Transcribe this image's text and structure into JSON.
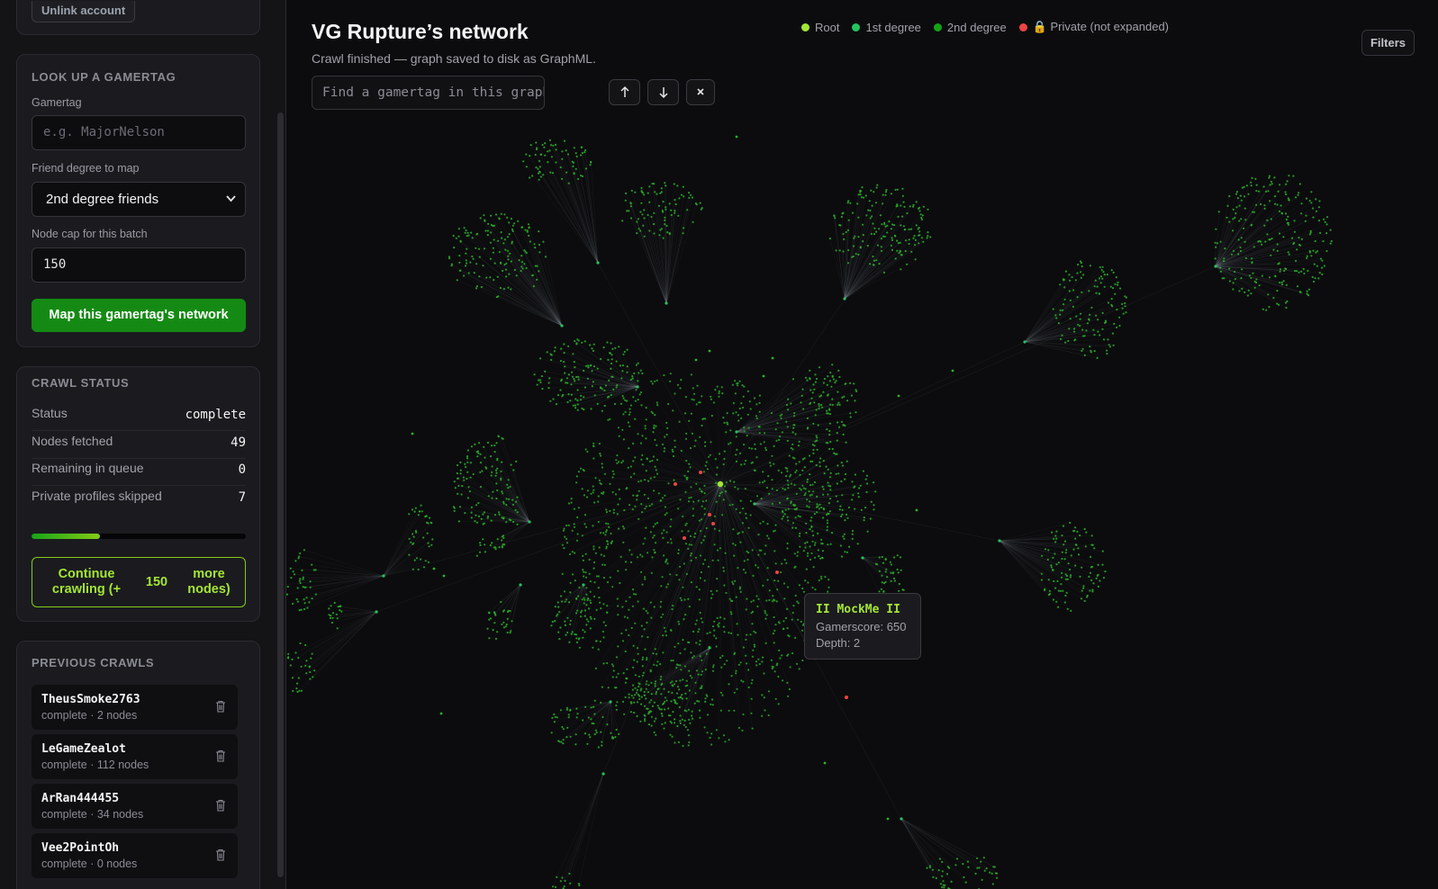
{
  "sidebar": {
    "unlink_label": "Unlink account",
    "lookup": {
      "title": "LOOK UP A GAMERTAG",
      "gamertag_label": "Gamertag",
      "gamertag_placeholder": "e.g. MajorNelson",
      "degree_label": "Friend degree to map",
      "degree_value": "2nd degree friends",
      "cap_label": "Node cap for this batch",
      "cap_value": "150",
      "map_button": "Map this gamertag's network"
    },
    "status": {
      "title": "CRAWL STATUS",
      "rows": [
        {
          "label": "Status",
          "value": "complete"
        },
        {
          "label": "Nodes fetched",
          "value": "49"
        },
        {
          "label": "Remaining in queue",
          "value": "0"
        },
        {
          "label": "Private profiles skipped",
          "value": "7"
        }
      ],
      "progress": 0.32,
      "continue_a": "Continue crawling (+",
      "continue_b": "150",
      "continue_c": "more nodes)"
    },
    "previous": {
      "title": "PREVIOUS CRAWLS",
      "items": [
        {
          "name": "TheusSmoke2763",
          "meta": "complete · 2 nodes"
        },
        {
          "name": "LeGameZealot",
          "meta": "complete · 112 nodes"
        },
        {
          "name": "ArRan444455",
          "meta": "complete · 34 nodes"
        },
        {
          "name": "Vee2PointOh",
          "meta": "complete · 0 nodes"
        }
      ]
    }
  },
  "main": {
    "title": "VG Rupture’s network",
    "subtitle": "Crawl finished — graph saved to disk as GraphML.",
    "find_placeholder": "Find a gamertag in this graph",
    "prev_icon": "arrow-up-icon",
    "next_icon": "arrow-down-icon",
    "clear_icon": "close-icon",
    "filters_label": "Filters",
    "legend": [
      {
        "label": "Root",
        "color": "#a3e635"
      },
      {
        "label": "1st degree",
        "color": "#22c55e"
      },
      {
        "label": "2nd degree",
        "color": "#15a315"
      },
      {
        "label": "🔒 Private (not expanded)",
        "color": "#ef4444"
      }
    ],
    "tooltip": {
      "name": "II MockMe II",
      "gamerscore": "Gamerscore: 650",
      "depth": "Depth: 2"
    }
  },
  "colors": {
    "accent": "#148a14",
    "root": "#a3e635",
    "node": "#2bb32b",
    "private": "#ef4444"
  }
}
